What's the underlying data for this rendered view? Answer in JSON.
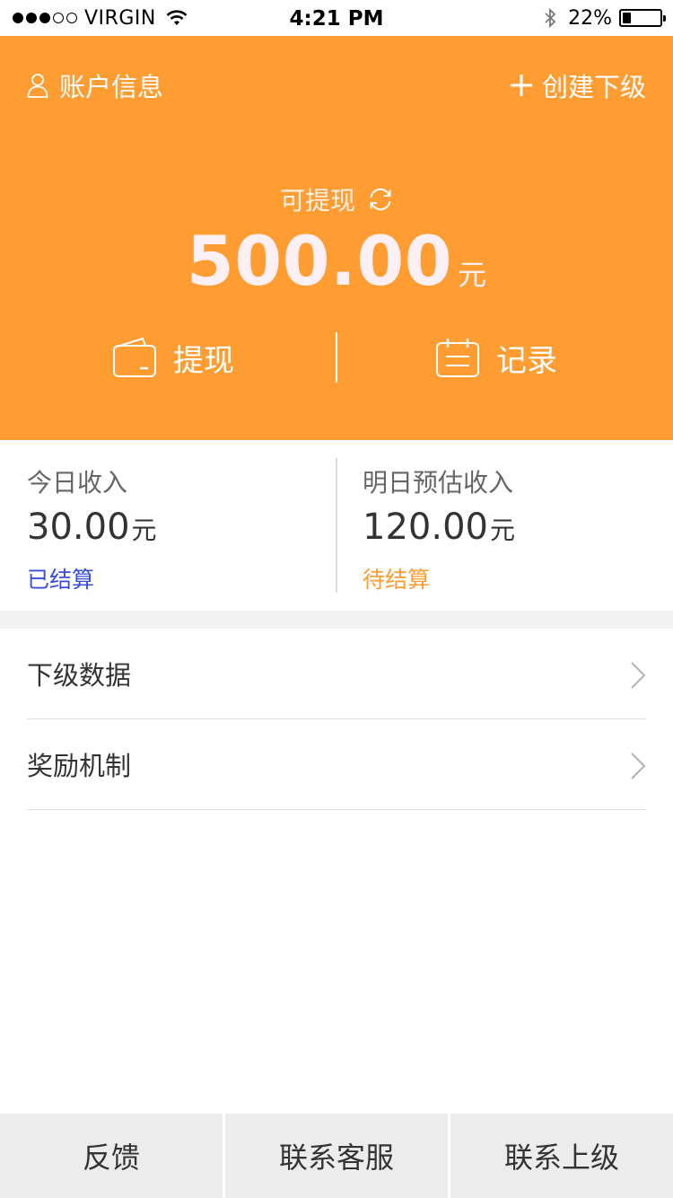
{
  "status_bar": {
    "signal_bars": 3,
    "carrier": "VIRGIN",
    "time": "4:21 PM",
    "battery_percent": "22%",
    "battery_level": 0.22
  },
  "header": {
    "account_label": "账户信息",
    "create_label": "创建下级",
    "available_label": "可提现",
    "balance": "500.00",
    "balance_unit": "元",
    "withdraw_label": "提现",
    "records_label": "记录"
  },
  "income": {
    "today": {
      "label": "今日收入",
      "value": "30.00",
      "unit": "元",
      "status": "已结算"
    },
    "tomorrow": {
      "label": "明日预估收入",
      "value": "120.00",
      "unit": "元",
      "status": "待结算"
    }
  },
  "list": [
    {
      "label": "下级数据"
    },
    {
      "label": "奖励机制"
    }
  ],
  "bottom": {
    "feedback": "反馈",
    "contact_service": "联系客服",
    "contact_superior": "联系上级"
  },
  "colors": {
    "accent": "#ff9c32",
    "settled": "#3a4fd8",
    "pending": "#ff9c32"
  }
}
